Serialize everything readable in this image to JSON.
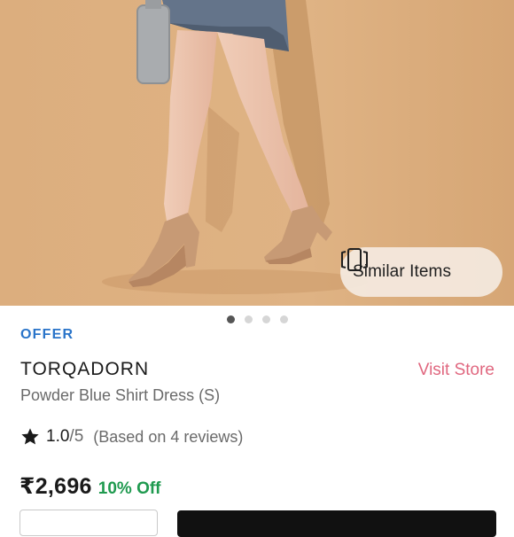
{
  "hero": {
    "similar_items_label": "Similar Items",
    "similar_icon": "similar-items-icon",
    "carousel": {
      "total": 4,
      "active_index": 0
    }
  },
  "product": {
    "offer_label": "OFFER",
    "brand": "TORQADORN",
    "visit_store_label": "Visit Store",
    "name": "Powder Blue Shirt Dress (S)",
    "rating_value": "1.0",
    "rating_max": "/5",
    "reviews_text": "(Based on 4 reviews)",
    "price": "₹2,696",
    "discount": "10% Off"
  },
  "colors": {
    "accent_blue": "#2a74c9",
    "visit_store": "#e0677f",
    "discount_green": "#1f9a4f",
    "hero_background": "#d9aa79"
  }
}
